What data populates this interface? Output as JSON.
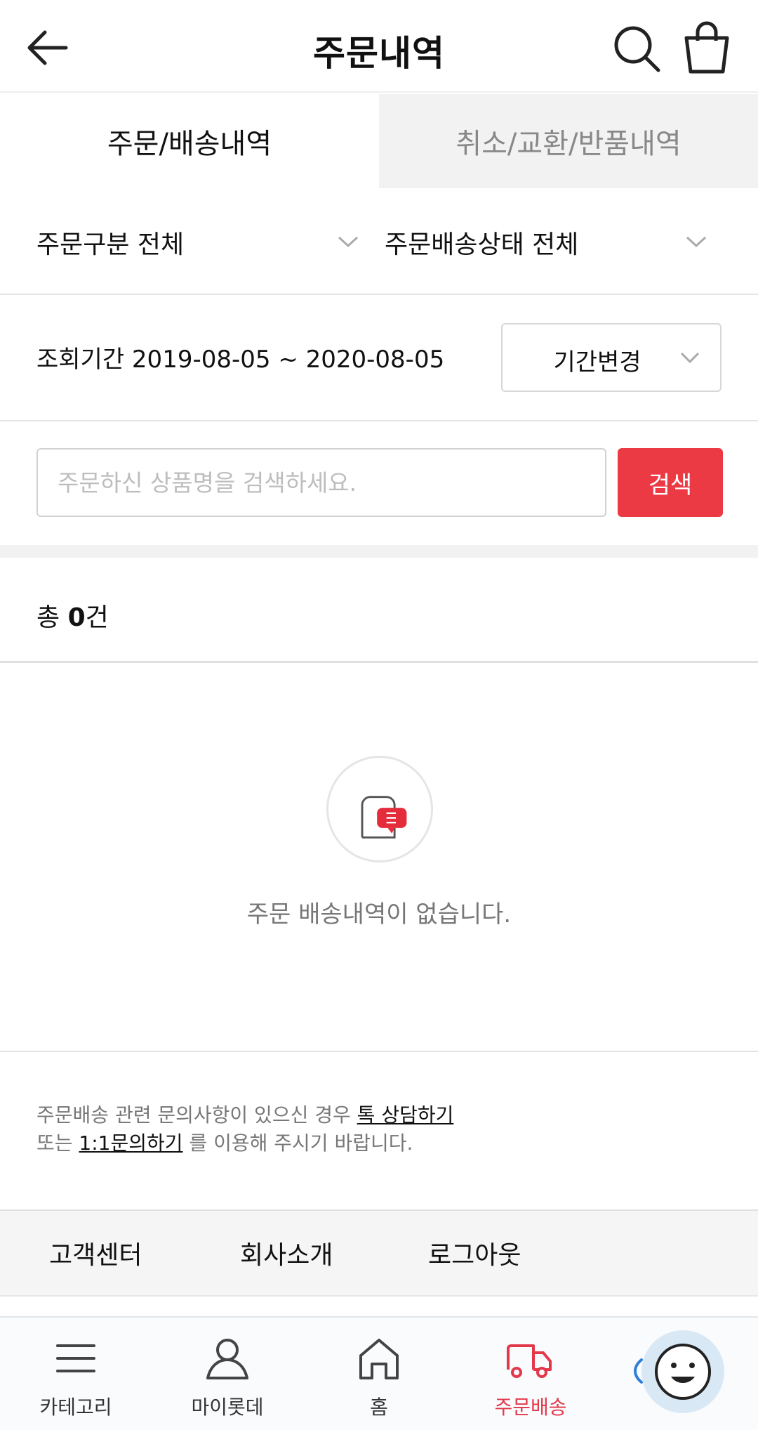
{
  "header": {
    "title": "주문내역",
    "icons": [
      "back-arrow-icon",
      "search-icon",
      "shopping-bag-icon"
    ]
  },
  "tabs": [
    {
      "label": "주문/배송내역",
      "active": true
    },
    {
      "label": "취소/교환/반품내역",
      "active": false
    }
  ],
  "filters": {
    "order_type": "주문구분 전체",
    "delivery_status": "주문배송상태 전체"
  },
  "period": {
    "label": "조회기간 2019-08-05 ~ 2020-08-05",
    "change_button": "기간변경"
  },
  "search": {
    "placeholder": "주문하신 상품명을 검색하세요.",
    "value": "",
    "button": "검색"
  },
  "count": {
    "prefix": "총 ",
    "number": "0",
    "suffix": "건"
  },
  "empty": {
    "message": "주문 배송내역이 없습니다."
  },
  "inquiry": {
    "line1_text": "주문배송 관련 문의사항이 있으신 경우 ",
    "talk_link": "톡 상담하기",
    "line2_prefix": "또는 ",
    "qna_link": "1:1문의하기",
    "line2_suffix": " 를 이용해 주시기 바랍니다."
  },
  "footer_links": [
    "고객센터",
    "회사소개",
    "로그아웃"
  ],
  "bottom_nav": [
    {
      "label": "카테고리",
      "icon": "menu-icon",
      "active": false
    },
    {
      "label": "마이롯데",
      "icon": "user-icon",
      "active": false
    },
    {
      "label": "홈",
      "icon": "home-icon",
      "active": false
    },
    {
      "label": "주문배송",
      "icon": "truck-icon",
      "active": true
    }
  ],
  "colors": {
    "accent": "#ec3a45",
    "active_nav": "#e3374a",
    "chatbot_bg": "#d9e8f5"
  }
}
